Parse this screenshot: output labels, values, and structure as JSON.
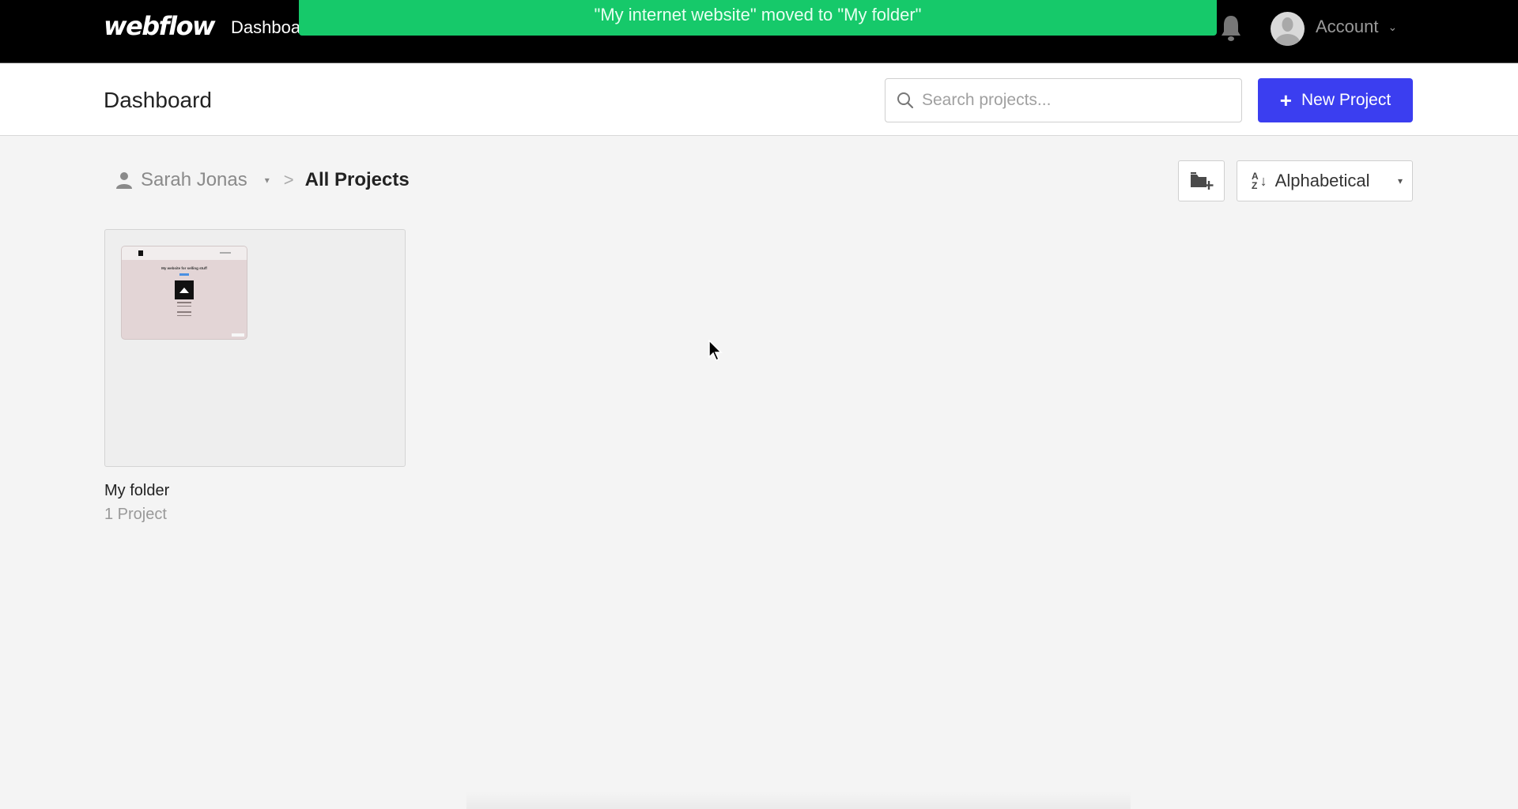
{
  "topnav": {
    "logo": "webflow",
    "nav_link": "Dashboa",
    "bell_icon": "bell-icon",
    "account_label": "Account",
    "account_chevron": "⌄"
  },
  "toast": {
    "message": "\"My internet website\" moved to \"My folder\"",
    "color": "#16c96a"
  },
  "header": {
    "title": "Dashboard",
    "search_placeholder": "Search projects...",
    "search_value": "",
    "new_project_label": "New Project",
    "new_project_icon": "+",
    "accent": "#3b3ef0"
  },
  "breadcrumb": {
    "user": "Sarah Jonas",
    "user_caret": "▾",
    "separator": ">",
    "current": "All Projects"
  },
  "toolbar": {
    "new_folder_icon": "folder-plus-icon",
    "sort_label": "Alphabetical",
    "sort_az_top": "A",
    "sort_az_bottom": "Z",
    "sort_arrow": "↓",
    "sort_caret": "▾"
  },
  "folders": [
    {
      "name": "My folder",
      "count": "1 Project",
      "thumbnail_title": "My website for selling stuff"
    }
  ]
}
